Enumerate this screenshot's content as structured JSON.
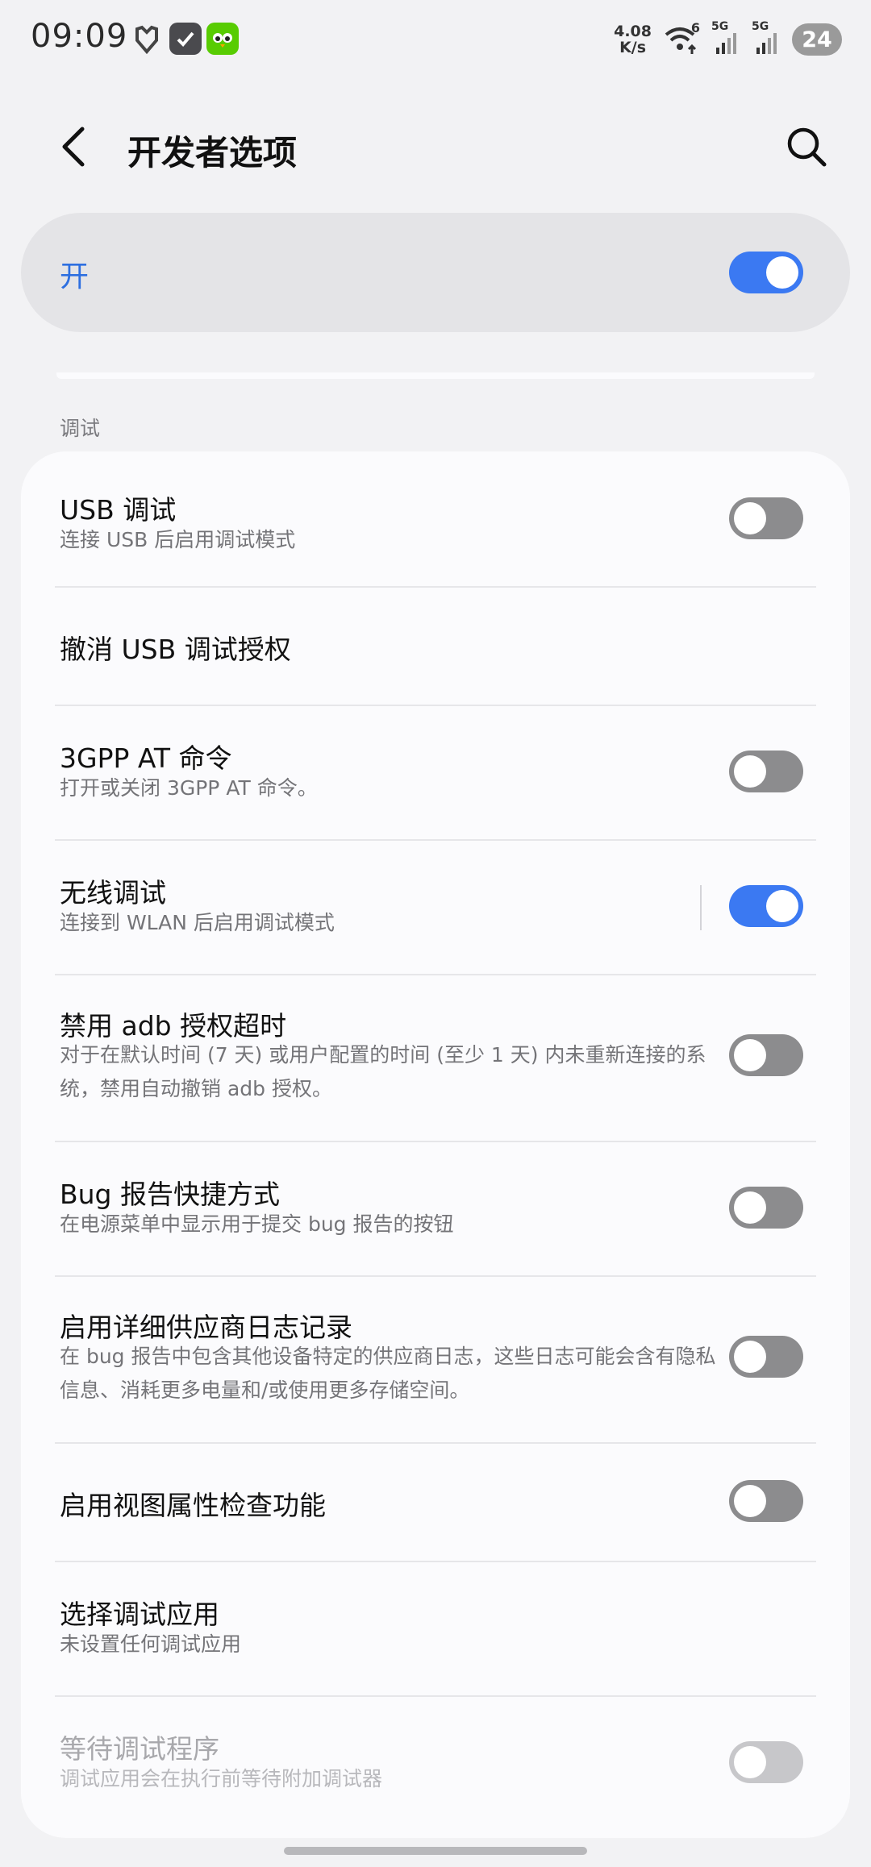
{
  "status_bar": {
    "time": "09:09",
    "net_speed_value": "4.08",
    "net_speed_unit": "K/s",
    "sim1_label": "5G",
    "sim2_label": "5G",
    "wifi_label": "6",
    "battery": "24"
  },
  "header": {
    "title": "开发者选项"
  },
  "master_switch": {
    "label": "开",
    "on": true
  },
  "section": {
    "header": "调试"
  },
  "items": [
    {
      "title": "USB 调试",
      "subtitle": "连接 USB 后启用调试模式",
      "toggle": "off"
    },
    {
      "title": "撤消 USB 调试授权",
      "subtitle": "",
      "toggle": "none"
    },
    {
      "title": "3GPP AT 命令",
      "subtitle": "打开或关闭 3GPP AT 命令。",
      "toggle": "off"
    },
    {
      "title": "无线调试",
      "subtitle": "连接到 WLAN 后启用调试模式",
      "toggle": "on"
    },
    {
      "title": "禁用 adb 授权超时",
      "subtitle": "对于在默认时间 (7 天) 或用户配置的时间 (至少 1 天) 内未重新连接的系统，禁用自动撤销 adb 授权。",
      "toggle": "off"
    },
    {
      "title": "Bug 报告快捷方式",
      "subtitle": "在电源菜单中显示用于提交 bug 报告的按钮",
      "toggle": "off"
    },
    {
      "title": "启用详细供应商日志记录",
      "subtitle": "在 bug 报告中包含其他设备特定的供应商日志，这些日志可能会含有隐私信息、消耗更多电量和/或使用更多存储空间。",
      "toggle": "off"
    },
    {
      "title": "启用视图属性检查功能",
      "subtitle": "",
      "toggle": "off"
    },
    {
      "title": "选择调试应用",
      "subtitle": "未设置任何调试应用",
      "toggle": "none"
    },
    {
      "title": "等待调试程序",
      "subtitle": "调试应用会在执行前等待附加调试器",
      "toggle": "disabled"
    }
  ],
  "colors": {
    "accent": "#3b79f2",
    "background": "#f2f2f4",
    "card": "#fbfbfd"
  }
}
